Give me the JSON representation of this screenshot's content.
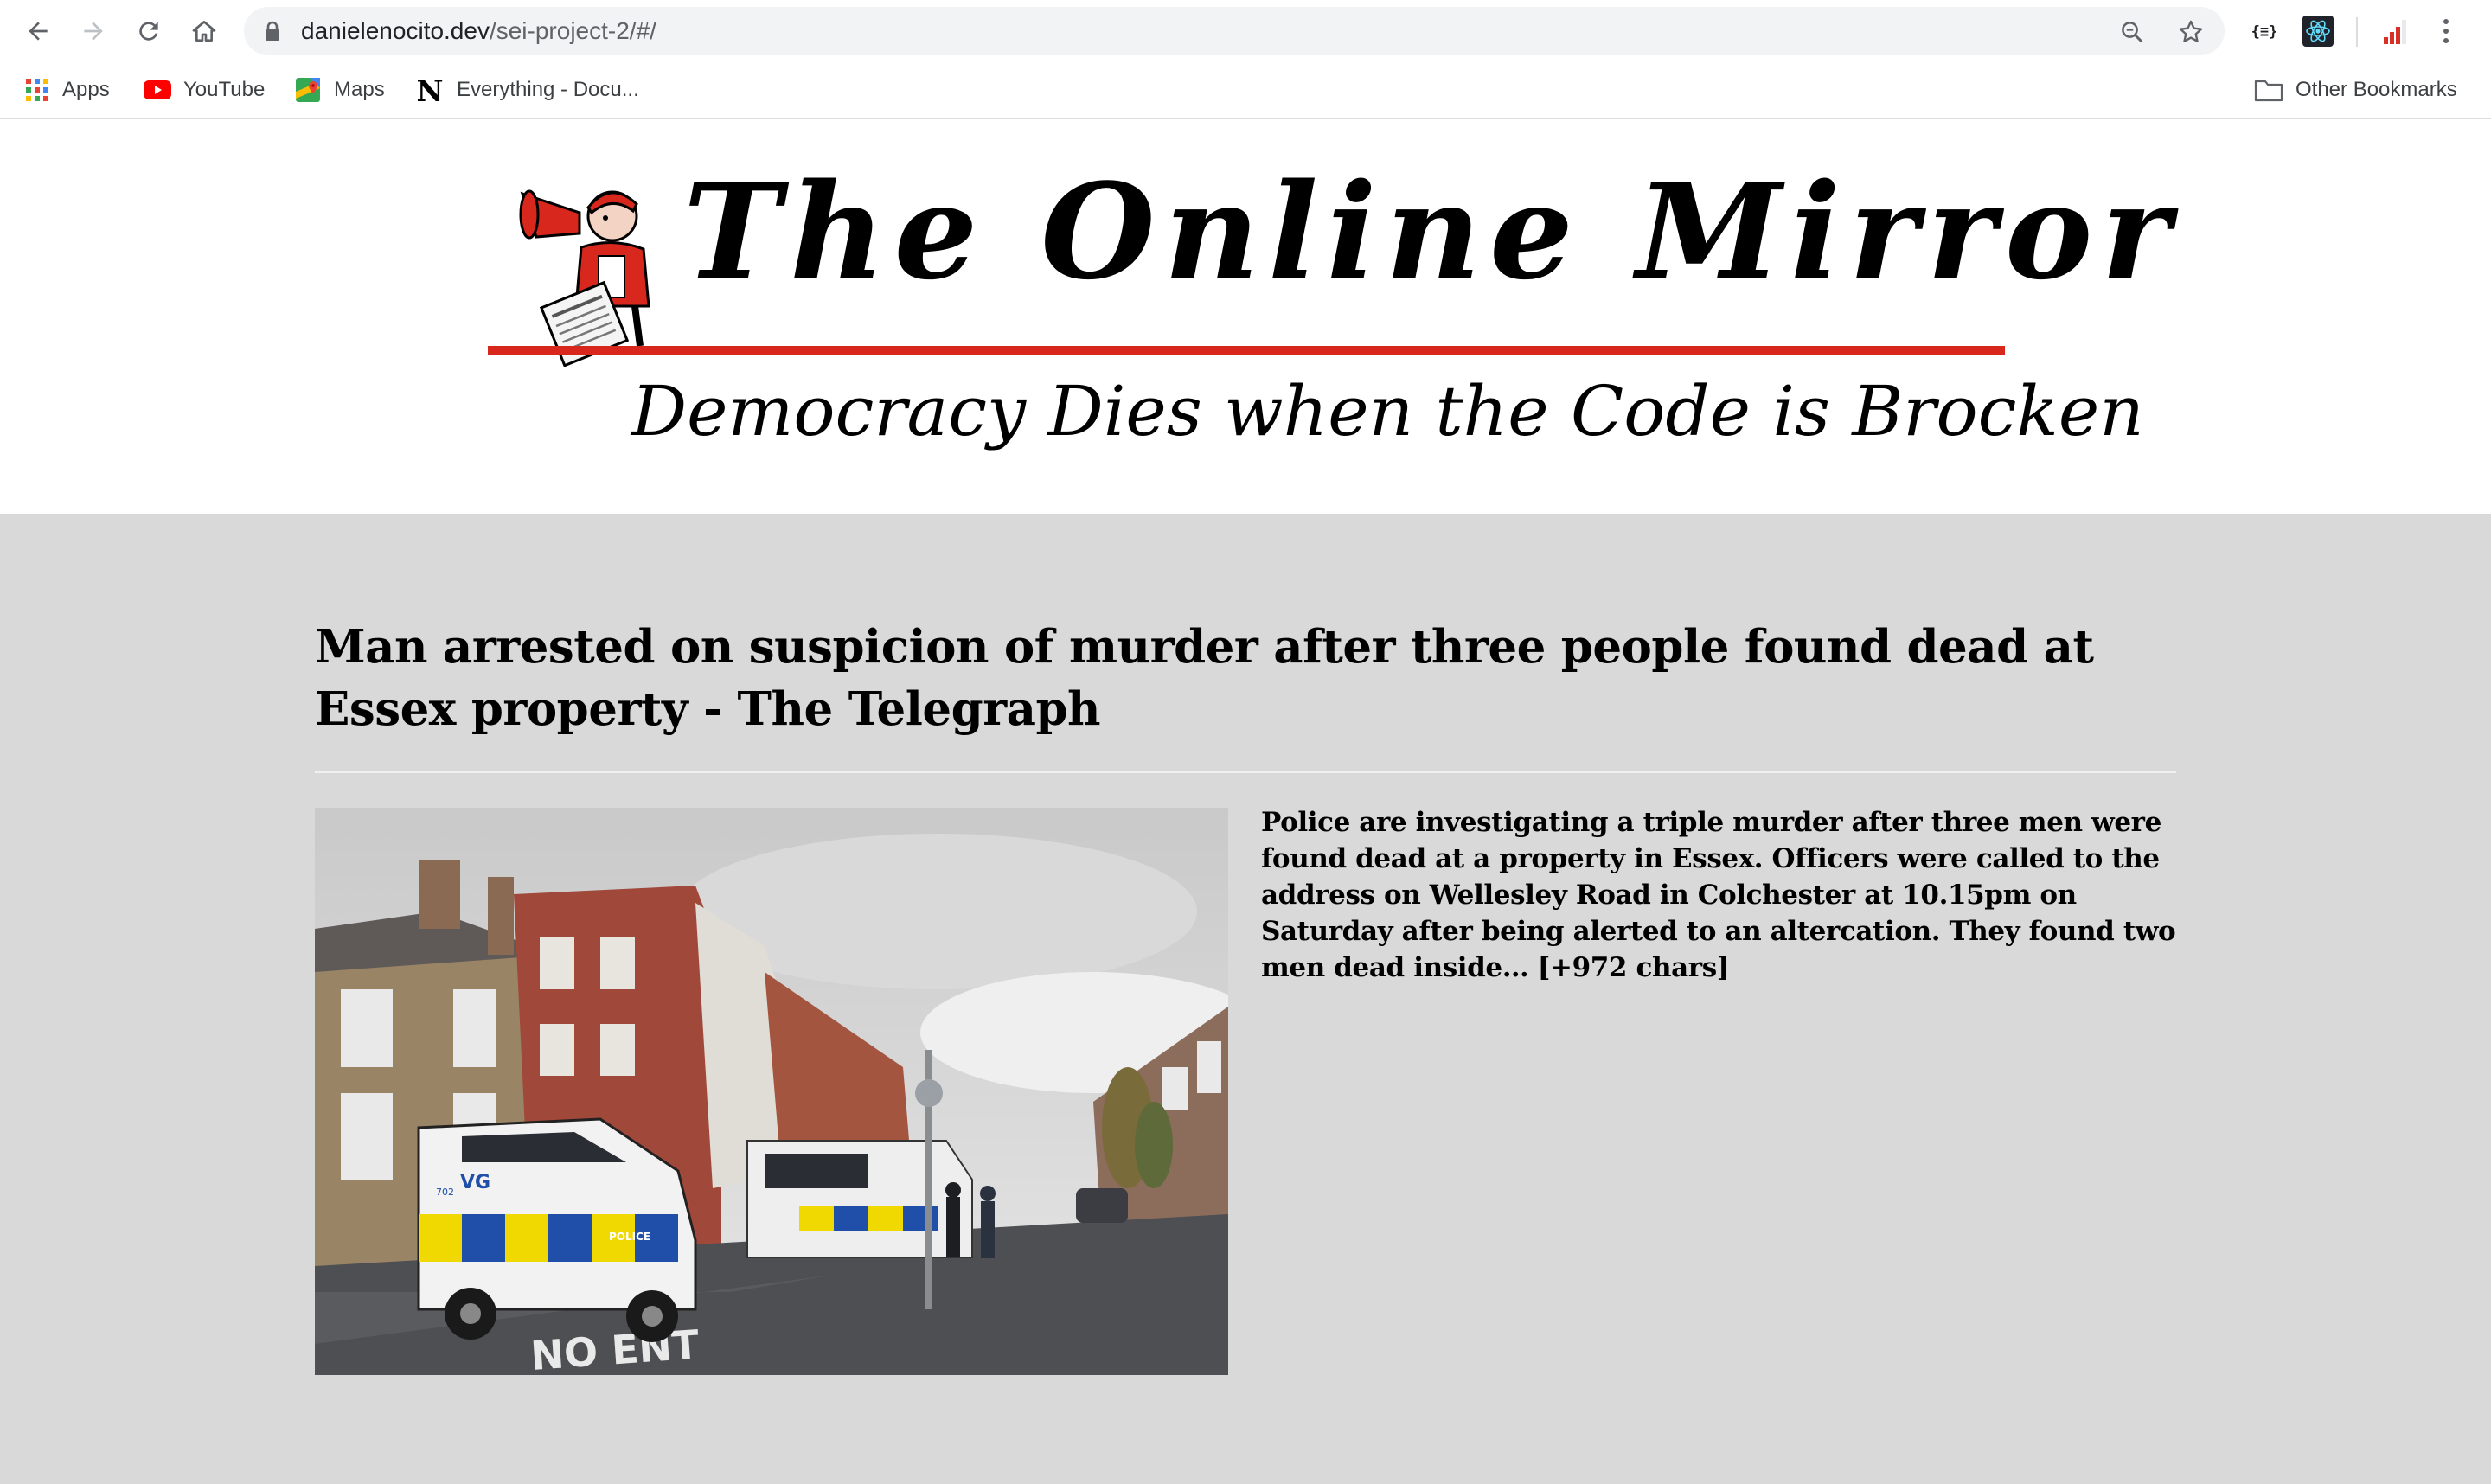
{
  "browser": {
    "url_host": "danielenocito.dev",
    "url_path": "/sei-project-2/#/",
    "nav": {
      "back_icon": "arrow-left-icon",
      "forward_icon": "arrow-right-icon",
      "reload_icon": "reload-icon",
      "home_icon": "home-icon"
    },
    "omnibox_icons": [
      "lock-icon",
      "zoom-icon",
      "star-icon"
    ],
    "extensions": [
      "json-viewer-icon",
      "react-devtools-icon",
      "signal-bars-icon"
    ],
    "menu_icon": "kebab-menu-icon"
  },
  "bookmarks": {
    "items": [
      {
        "label": "Apps",
        "icon": "apps-grid-icon"
      },
      {
        "label": "YouTube",
        "icon": "youtube-icon"
      },
      {
        "label": "Maps",
        "icon": "maps-icon"
      },
      {
        "label": "Everything - Docu...",
        "icon": "n-logo-icon"
      }
    ],
    "other_label": "Other Bookmarks",
    "other_icon": "folder-icon"
  },
  "site": {
    "title": "The Online Mirror",
    "tagline": "Democracy Dies when the Code is Brocken",
    "accent_color": "#d8281d",
    "logo_icon": "megaphone-mascot-icon"
  },
  "article": {
    "headline": "Man arrested on suspicion of murder after three people found dead at Essex property - The Telegraph",
    "summary": "Police are investigating a triple murder after three men were found dead at a property in Essex. Officers were called to the address on Wellesley Road in Colchester at 10.15pm on Saturday after being alerted to an altercation. They found two men dead inside… [+972 chars]",
    "image_signs": {
      "van_tag": "VG",
      "van_number": "702",
      "road_marking": "NO ENT",
      "livery": "POLICE"
    }
  }
}
